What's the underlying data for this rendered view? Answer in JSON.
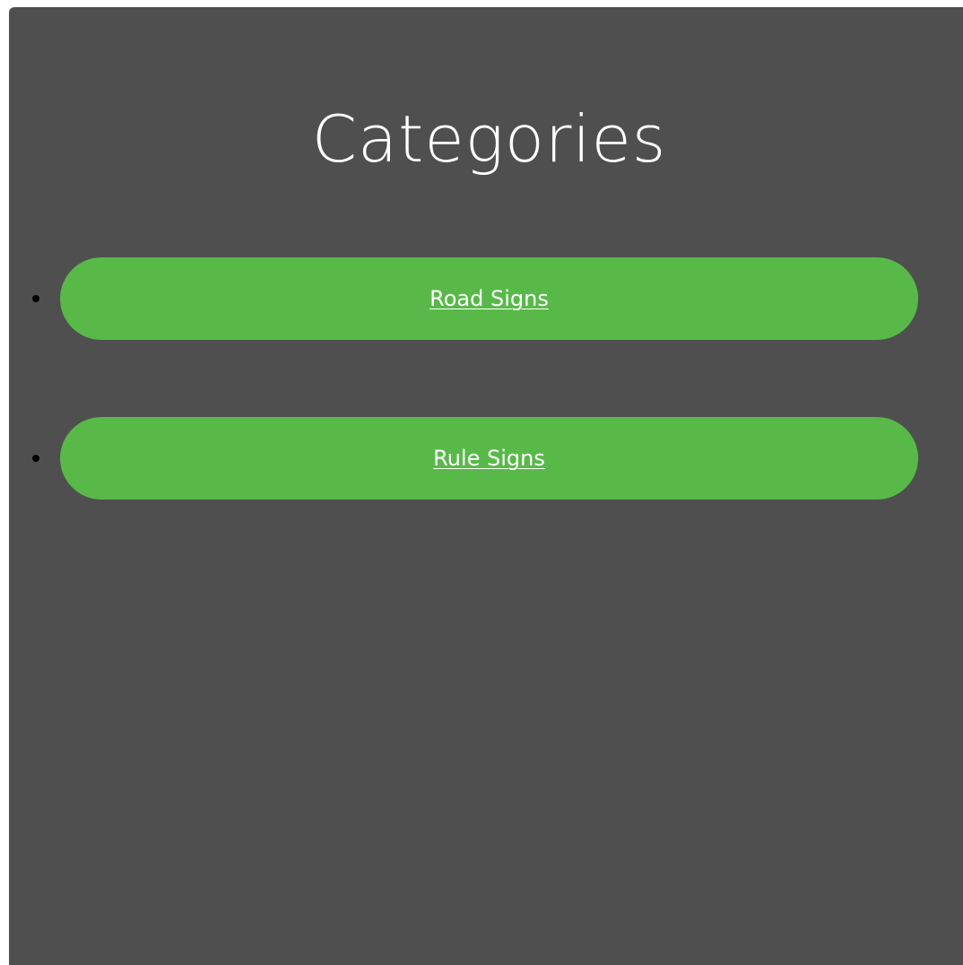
{
  "page": {
    "title": "Categories"
  },
  "categories": [
    {
      "label": "Road Signs"
    },
    {
      "label": "Rule Signs"
    }
  ],
  "colors": {
    "panel_background": "#4f4f4f",
    "button_background": "#58b949",
    "text": "#ffffff",
    "bullet": "#000000"
  }
}
